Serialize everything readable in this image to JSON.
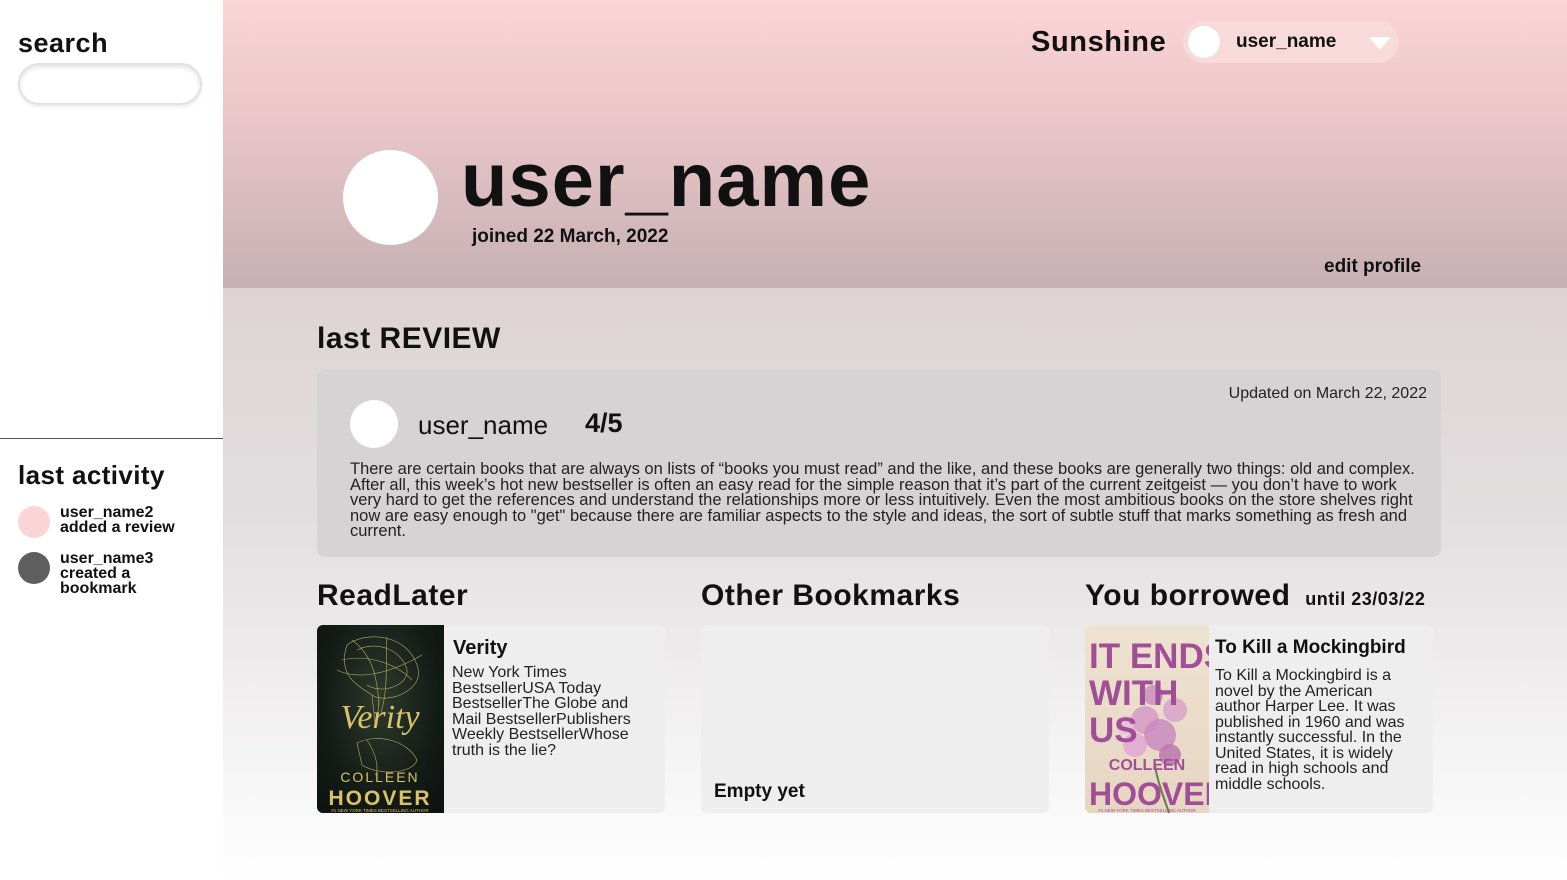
{
  "sidebar": {
    "search_label": "search",
    "search_placeholder": "",
    "activity_title": "last activity",
    "activity": [
      {
        "user": "user_name2",
        "action": "added a review",
        "dot_color": "#fbd4d6"
      },
      {
        "user": "user_name3",
        "action_line1": "created a",
        "action_line2": "bookmark",
        "dot_color": "#5e5e5e"
      }
    ]
  },
  "header": {
    "brand": "Sunshine",
    "account_name": "user_name",
    "profile_name": "user_name",
    "joined": "joined 22 March, 2022",
    "edit_profile": "edit profile"
  },
  "review": {
    "section_title": "last REVIEW",
    "updated": "Updated on March 22, 2022",
    "user": "user_name",
    "rating": "4/5",
    "text": "There are certain books that are always on lists of “books you must read” and the like, and these books are generally two things: old and complex. After all, this week’s hot new bestseller is often an easy read for the simple reason that it’s part of the current zeitgeist — you don’t have to work very hard to get the references and understand the relationships more or less intuitively. Even the most ambitious books on the store shelves right now are easy enough to \"get\" because there are familiar aspects to the style and ideas, the sort of subtle stuff that marks something as fresh and current."
  },
  "read_later": {
    "title": "ReadLater",
    "book_title": "Verity",
    "book_desc": "New York Times BestsellerUSA Today BestsellerThe Globe and Mail BestsellerPublishers Weekly BestsellerWhose truth is the lie?",
    "cover_title": "Verity",
    "cover_author_line1": "COLLEEN",
    "cover_author_line2": "HOOVER",
    "cover_banner": "#1 NEW YORK TIMES BESTSELLING AUTHOR"
  },
  "other_bookmarks": {
    "title": "Other Bookmarks",
    "empty_text": "Empty yet"
  },
  "borrowed": {
    "title": "You borrowed",
    "until": "until 23/03/22",
    "book_title": "To Kill a Mockingbird",
    "book_desc": "To Kill a Mockingbird is a novel by the American author Harper Lee. It was published in 1960 and was instantly successful. In the United States, it is widely read in high schools and middle schools.",
    "cover_line1": "IT ENDS",
    "cover_line2": "WITH",
    "cover_line3": "US",
    "cover_author_line1": "COLLEEN",
    "cover_author_line2": "HOOVER",
    "cover_banner": "#1 NEW YORK TIMES BESTSELLING AUTHOR"
  },
  "colors": {
    "header_top": "#fbd4d6",
    "header_bottom": "#c6b0b3",
    "review_card": "#d7d2d3",
    "book_card": "#efeeee"
  }
}
